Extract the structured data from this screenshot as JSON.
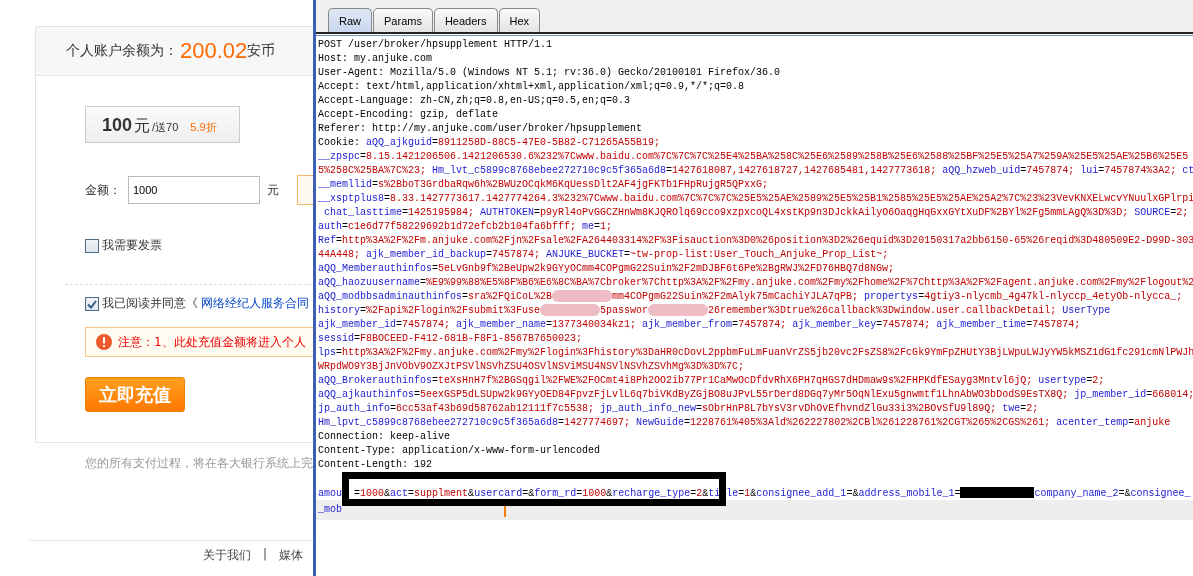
{
  "account_page": {
    "balance_label": "个人账户余额为：",
    "balance": "200.02",
    "balance_unit": "安币",
    "package": {
      "amount": "100",
      "unit": "元",
      "bonus": "/送70",
      "discount": "5.9折"
    },
    "amount_field": {
      "label": "金额：",
      "value": "1000",
      "unit": "元"
    },
    "checkboxes": [
      {
        "label": "我需要发票",
        "checked": false
      },
      {
        "label": "我已阅读并同意《",
        "link": "网络经纪人服务合同",
        "checked": true
      }
    ],
    "notice": "注意：1、此处充值金额将进入个人",
    "submit_button": "立即充值",
    "payment_note": "您的所有支付过程，将在各大银行系统上完",
    "footer": {
      "links": [
        "关于我们",
        "媒体"
      ],
      "separator": "|"
    }
  },
  "request_panel": {
    "tabs": [
      {
        "label": "Raw",
        "selected": true
      },
      {
        "label": "Params",
        "selected": false
      },
      {
        "label": "Headers",
        "selected": false
      },
      {
        "label": "Hex",
        "selected": false
      }
    ],
    "lines": [
      {
        "segments": [
          {
            "kind": "plain",
            "text": "POST /user/broker/hpsupplement HTTP/1.1"
          }
        ]
      },
      {
        "segments": [
          {
            "kind": "plain",
            "text": "Host: my.anjuke.com"
          }
        ]
      },
      {
        "segments": [
          {
            "kind": "plain",
            "text": "User-Agent: Mozilla/5.0 (Windows NT 5.1; rv:36.0) Gecko/20100101 Firefox/36.0"
          }
        ]
      },
      {
        "segments": [
          {
            "kind": "plain",
            "text": "Accept: text/html,application/xhtml+xml,application/xml;q=0.9,*/*;q=0.8"
          }
        ]
      },
      {
        "segments": [
          {
            "kind": "plain",
            "text": "Accept-Language: zh-CN,zh;q=0.8,en-US;q=0.5,en;q=0.3"
          }
        ]
      },
      {
        "segments": [
          {
            "kind": "plain",
            "text": "Accept-Encoding: gzip, deflate"
          }
        ]
      },
      {
        "segments": [
          {
            "kind": "plain",
            "text": "Referer: http://my.anjuke.com/user/broker/hpsupplement"
          }
        ]
      },
      {
        "segments": [
          {
            "kind": "plain",
            "text": "Cookie: "
          },
          {
            "kind": "name",
            "text": "aQQ_ajkguid"
          },
          {
            "kind": "plain",
            "text": "="
          },
          {
            "kind": "value",
            "text": "8911258D-88C5-47E0-5B82-C71265A55B19;"
          }
        ]
      },
      {
        "segments": [
          {
            "kind": "name",
            "text": "__zpspc"
          },
          {
            "kind": "plain",
            "text": "="
          },
          {
            "kind": "value",
            "text": "8.15.1421206506.1421206530.6%232%7Cwww.baidu.com%7C%7C%7C%25E4%25BA%258C%25E6%2589%258B%25E6%2588%25BF%25E5%25A7%259A%25E5%25AE%25B6%25E5"
          }
        ]
      },
      {
        "segments": [
          {
            "kind": "value",
            "text": "5%258C%25BA%7C%23; "
          },
          {
            "kind": "name",
            "text": "Hm_lvt_c5899c8768ebee272710c9c5f365a6d8"
          },
          {
            "kind": "plain",
            "text": "="
          },
          {
            "kind": "value",
            "text": "1427618087,1427618727,1427685481,1427773618; "
          },
          {
            "kind": "name",
            "text": "aQQ_hzweb_uid"
          },
          {
            "kind": "plain",
            "text": "="
          },
          {
            "kind": "value",
            "text": "7457874; "
          },
          {
            "kind": "name",
            "text": "lui"
          },
          {
            "kind": "plain",
            "text": "="
          },
          {
            "kind": "value",
            "text": "7457874%3A2; "
          },
          {
            "kind": "name",
            "text": "ct"
          }
        ]
      },
      {
        "segments": [
          {
            "kind": "name",
            "text": "__memllid"
          },
          {
            "kind": "plain",
            "text": "="
          },
          {
            "kind": "value",
            "text": "s%2BboT3GrdbaRqw6h%2BWUzOCqkM6KqUessDlt2AF4jgFKTb1FHpRujgR5QPxxG;"
          }
        ]
      },
      {
        "segments": [
          {
            "kind": "name",
            "text": "__xsptplus8"
          },
          {
            "kind": "plain",
            "text": "="
          },
          {
            "kind": "value",
            "text": "8.33.1427773617.1427774264.3%232%7Cwww.baidu.com%7C%7C%7C%25E5%25AE%2589%25E5%25B1%2585%25E5%25AE%25A2%7C%23%23VevKNXELwcvYNuulxGPlrpi"
          }
        ]
      },
      {
        "segments": [
          {
            "kind": "name",
            "text": " chat_lasttime"
          },
          {
            "kind": "plain",
            "text": "="
          },
          {
            "kind": "value",
            "text": "1425195984; "
          },
          {
            "kind": "name",
            "text": "AUTHTOKEN"
          },
          {
            "kind": "plain",
            "text": "="
          },
          {
            "kind": "value",
            "text": "p9yRl4oPvGGCZHnWm8KJQROlq69cco9xzpxcoQL4xstKp9n3DJckkAilyO6OaqgHqGxxGYtXuDF%2BYl%2Fg5mmLAgQ%3D%3D; "
          },
          {
            "kind": "name",
            "text": "SOURCE"
          },
          {
            "kind": "plain",
            "text": "="
          },
          {
            "kind": "value",
            "text": "2;"
          }
        ]
      },
      {
        "segments": [
          {
            "kind": "name",
            "text": "auth"
          },
          {
            "kind": "plain",
            "text": "="
          },
          {
            "kind": "value",
            "text": "c1e6d77f58229692b1d72efcb2b104fa6bfff; "
          },
          {
            "kind": "name",
            "text": "me"
          },
          {
            "kind": "plain",
            "text": "="
          },
          {
            "kind": "value",
            "text": "1;"
          }
        ]
      },
      {
        "segments": [
          {
            "kind": "name",
            "text": "Ref"
          },
          {
            "kind": "plain",
            "text": "="
          },
          {
            "kind": "value",
            "text": "http%3A%2F%2Fm.anjuke.com%2Fjn%2Fsale%2FA264403314%2F%3Fisauction%3D0%26position%3D2%26equid%3D20150317a2bb6150-65%26reqid%3D480509E2-D99D-303"
          }
        ]
      },
      {
        "segments": [
          {
            "kind": "value",
            "text": "44A448; "
          },
          {
            "kind": "name",
            "text": "ajk_member_id_backup"
          },
          {
            "kind": "plain",
            "text": "="
          },
          {
            "kind": "value",
            "text": "7457874; "
          },
          {
            "kind": "name",
            "text": "ANJUKE_BUCKET"
          },
          {
            "kind": "plain",
            "text": "="
          },
          {
            "kind": "value",
            "text": "~tw-prop-list:User_Touch_Anjuke_Prop_List~;"
          }
        ]
      },
      {
        "segments": [
          {
            "kind": "name",
            "text": "aQQ_Memberauthinfos"
          },
          {
            "kind": "plain",
            "text": "="
          },
          {
            "kind": "value",
            "text": "5eLvGnb9f%2BeUpw2k9GYyOCmm4COPgmG22Suin%2F2mDJBF6t6Pe%2BgRWJ%2FD76HBQ7d8NGw;"
          }
        ]
      },
      {
        "segments": [
          {
            "kind": "name",
            "text": "aQQ_haozuusername"
          },
          {
            "kind": "plain",
            "text": "="
          },
          {
            "kind": "value",
            "text": "%E9%99%88%E5%8F%B6%E6%8C%BA%7Cbroker%7Chttp%3A%2F%2Fmy.anjuke.com%2Fmy%2Fhome%2F%7Chttp%3A%2F%2Fagent.anjuke.com%2Fmy%2Flogout%2"
          }
        ]
      },
      {
        "segments": [
          {
            "kind": "name",
            "text": "aQQ_modbbsadminauthinfos"
          },
          {
            "kind": "plain",
            "text": "="
          },
          {
            "kind": "value",
            "text": "sra%2FQiCoL%2B"
          },
          {
            "kind": "blur"
          },
          {
            "kind": "value",
            "text": "mm4COPgmG22Suin%2F2mAlyk75mCachiYJLA7qPB; "
          },
          {
            "kind": "name",
            "text": "propertys"
          },
          {
            "kind": "plain",
            "text": "="
          },
          {
            "kind": "value",
            "text": "4gtiy3-nlycmb_4g47kl-nlyccp_4etyOb-nlycca_;"
          }
        ]
      },
      {
        "segments": [
          {
            "kind": "name",
            "text": "history"
          },
          {
            "kind": "plain",
            "text": "="
          },
          {
            "kind": "value",
            "text": "%2Fapi%2Flogin%2Fsubmit%3Fuse"
          },
          {
            "kind": "blur"
          },
          {
            "kind": "value",
            "text": "5passwor"
          },
          {
            "kind": "blur"
          },
          {
            "kind": "value",
            "text": "26remember%3Dtrue%26callback%3Dwindow.user.callbackDetail; "
          },
          {
            "kind": "name",
            "text": "UserType"
          }
        ]
      },
      {
        "segments": [
          {
            "kind": "name",
            "text": "ajk_member_id"
          },
          {
            "kind": "plain",
            "text": "="
          },
          {
            "kind": "value",
            "text": "7457874; "
          },
          {
            "kind": "name",
            "text": "ajk_member_name"
          },
          {
            "kind": "plain",
            "text": "="
          },
          {
            "kind": "value",
            "text": "1377340034kz1; "
          },
          {
            "kind": "name",
            "text": "ajk_member_from"
          },
          {
            "kind": "plain",
            "text": "="
          },
          {
            "kind": "value",
            "text": "7457874; "
          },
          {
            "kind": "name",
            "text": "ajk_member_key"
          },
          {
            "kind": "plain",
            "text": "="
          },
          {
            "kind": "value",
            "text": "7457874; "
          },
          {
            "kind": "name",
            "text": "ajk_member_time"
          },
          {
            "kind": "plain",
            "text": "="
          },
          {
            "kind": "value",
            "text": "7457874;"
          }
        ]
      },
      {
        "segments": [
          {
            "kind": "name",
            "text": "sessid"
          },
          {
            "kind": "plain",
            "text": "="
          },
          {
            "kind": "value",
            "text": "F8BOCEED-F412-681B-F8F1-8567B7650023;"
          }
        ]
      },
      {
        "segments": [
          {
            "kind": "name",
            "text": "lps"
          },
          {
            "kind": "plain",
            "text": "="
          },
          {
            "kind": "value",
            "text": "http%3A%2F%2Fmy.anjuke.com%2Fmy%2Flogin%3Fhistory%3DaHR0cDovL2ppbmFuLmFuanVrZS5jb20vc2FsZS8%2FcGk9YmFpZHUtY3BjLWpuLWJyYW5kMSZ1dG1fc291cmNlPWJh"
          }
        ]
      },
      {
        "segments": [
          {
            "kind": "value",
            "text": "WRpdWO9Y3BjJnVObV9OZXJtPSVlNSVhZSU4OSVlNSViMSU4NSVlNSVhZSVhMg%3D%3D%7C;"
          }
        ]
      },
      {
        "segments": [
          {
            "kind": "name",
            "text": "aQQ_Brokerauthinfos"
          },
          {
            "kind": "plain",
            "text": "="
          },
          {
            "kind": "value",
            "text": "teXsHnH7f%2BGSqgil%2FWE%2FOCmt4i8Ph2OO2ib77Pr1CaMwOcDfdvRhX6PH7qHGS7dHDmaw9s%2FHPKdfESayg3Mntvl6jQ; "
          },
          {
            "kind": "name",
            "text": "usertype"
          },
          {
            "kind": "plain",
            "text": "="
          },
          {
            "kind": "value",
            "text": "2;"
          }
        ]
      },
      {
        "segments": [
          {
            "kind": "name",
            "text": "aQQ_ajkauthinfos"
          },
          {
            "kind": "plain",
            "text": "="
          },
          {
            "kind": "value",
            "text": "5eexGSP5dLSUpw2k9GYyOED84FpvzFjLvlL6q7biVKdByZGjBO8uJPvL55rDerd8DGq7yMr5OqNlExu5gnwmtf1LhnAbWO3bDodS9EsTX8Q; "
          },
          {
            "kind": "name",
            "text": "jp_member_id"
          },
          {
            "kind": "plain",
            "text": "="
          },
          {
            "kind": "value",
            "text": "668014;"
          }
        ]
      },
      {
        "segments": [
          {
            "kind": "name",
            "text": "jp_auth_info"
          },
          {
            "kind": "plain",
            "text": "="
          },
          {
            "kind": "value",
            "text": "6cc53af43b69d58762ab12111f7c5538; "
          },
          {
            "kind": "name",
            "text": "jp_auth_info_new"
          },
          {
            "kind": "plain",
            "text": "="
          },
          {
            "kind": "value",
            "text": "sObrHnP8L7bYsV3rvDhOvEfhvndZlGu33i3%2BOvSfU9l89Q; "
          },
          {
            "kind": "name",
            "text": "twe"
          },
          {
            "kind": "plain",
            "text": "="
          },
          {
            "kind": "value",
            "text": "2;"
          }
        ]
      },
      {
        "segments": [
          {
            "kind": "name",
            "text": "Hm_lpvt_c5899c8768ebee272710c9c5f365a6d8"
          },
          {
            "kind": "plain",
            "text": "="
          },
          {
            "kind": "value",
            "text": "1427774697; "
          },
          {
            "kind": "name",
            "text": "NewGuide"
          },
          {
            "kind": "plain",
            "text": "="
          },
          {
            "kind": "value",
            "text": "1228761%405%3Ald%262227802%2CBl%261228761%2CGT%265%2CGS%261; "
          },
          {
            "kind": "name",
            "text": "acenter_temp"
          },
          {
            "kind": "plain",
            "text": "="
          },
          {
            "kind": "value",
            "text": "anjuke"
          }
        ]
      },
      {
        "segments": [
          {
            "kind": "plain",
            "text": "Connection: keep-alive"
          }
        ]
      },
      {
        "segments": [
          {
            "kind": "plain",
            "text": "Content-Type: application/x-www-form-urlencoded"
          }
        ]
      },
      {
        "segments": [
          {
            "kind": "plain",
            "text": "Content-Length: 192"
          }
        ]
      },
      {
        "blank_before": true,
        "segments": [
          {
            "kind": "name",
            "text": "amou"
          },
          {
            "kind": "covered"
          },
          {
            "kind": "covered"
          },
          {
            "kind": "plain",
            "text": "="
          },
          {
            "kind": "value",
            "text": "1000"
          },
          {
            "kind": "plain",
            "text": "&"
          },
          {
            "kind": "name",
            "text": "act"
          },
          {
            "kind": "plain",
            "text": "="
          },
          {
            "kind": "value",
            "text": "supplment"
          },
          {
            "kind": "plain",
            "text": "&"
          },
          {
            "kind": "name",
            "text": "usercard"
          },
          {
            "kind": "plain",
            "text": "=&"
          },
          {
            "kind": "name",
            "text": "form_rd"
          },
          {
            "kind": "plain",
            "text": "="
          },
          {
            "kind": "value",
            "text": "1000"
          },
          {
            "kind": "plain",
            "text": "&"
          },
          {
            "kind": "name",
            "text": "recharge_type"
          },
          {
            "kind": "plain",
            "text": "="
          },
          {
            "kind": "value",
            "text": "2"
          },
          {
            "kind": "plain",
            "text": "&"
          },
          {
            "kind": "name",
            "text": "ti"
          },
          {
            "kind": "covered"
          },
          {
            "kind": "name",
            "text": "le"
          },
          {
            "kind": "plain",
            "text": "="
          },
          {
            "kind": "value",
            "text": "1"
          },
          {
            "kind": "plain",
            "text": "&"
          },
          {
            "kind": "name",
            "text": "consignee_add_1"
          },
          {
            "kind": "plain",
            "text": "=&"
          },
          {
            "kind": "name",
            "text": "address_mobile_1"
          },
          {
            "kind": "plain",
            "text": "="
          },
          {
            "kind": "redacted"
          },
          {
            "kind": "name",
            "text": "company_name_2"
          },
          {
            "kind": "plain",
            "text": "=&"
          },
          {
            "kind": "name",
            "text": "consignee_"
          }
        ]
      },
      {
        "current": true,
        "segments": [
          {
            "kind": "name",
            "text": "_mob"
          }
        ]
      }
    ]
  }
}
